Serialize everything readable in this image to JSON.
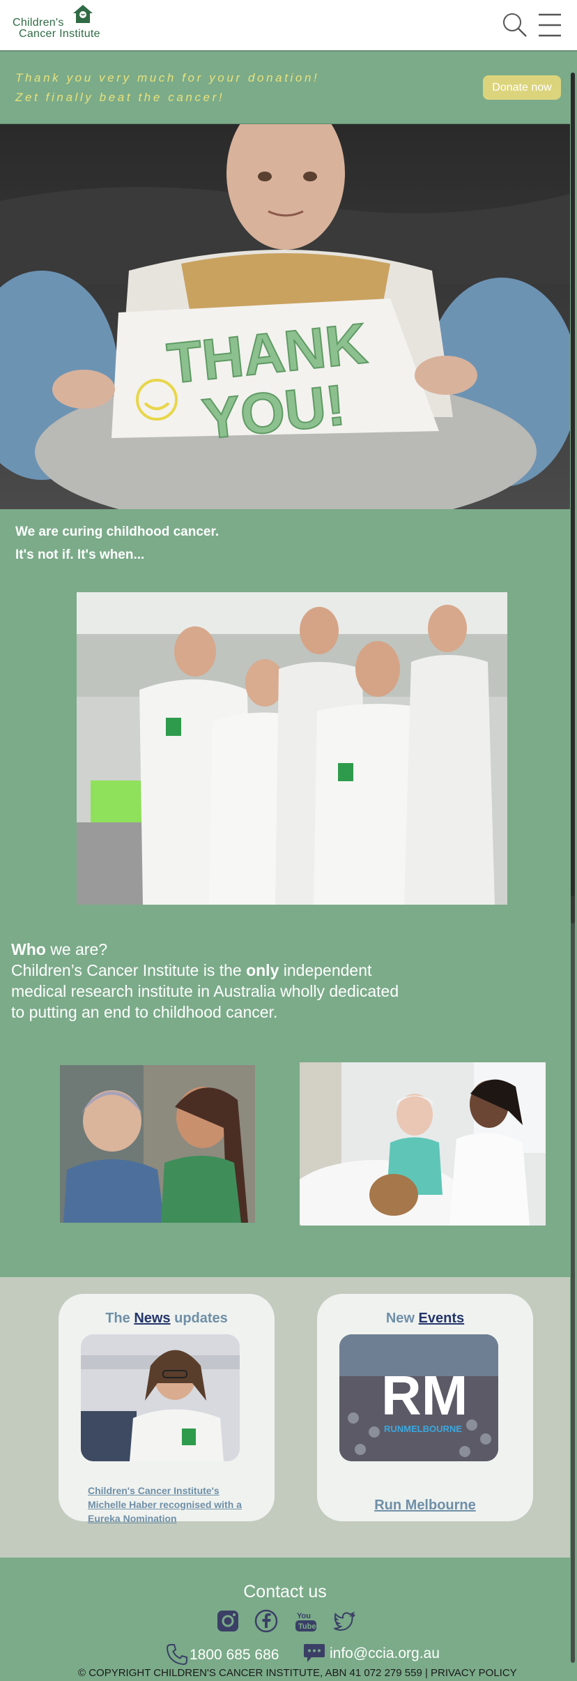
{
  "header": {
    "logo_line1": "Children's",
    "logo_line2": "Cancer Institute",
    "search_icon": "search-icon",
    "menu_icon": "hamburger-menu-icon"
  },
  "banner": {
    "line1": "Thank you very much for your donation!",
    "line2": "Zet finally beat the cancer!",
    "donate_label": "Donate now"
  },
  "hero": {
    "sign_line1": "THANK",
    "sign_line2": "YOU!"
  },
  "intro": {
    "line1": "We are curing childhood cancer.",
    "line2": "It's not if. It's when..."
  },
  "who": {
    "who_word": "Who",
    "who_rest": " we are?",
    "text_a": "Children’s Cancer Institute is the ",
    "only_word": "only",
    "text_b": " independent medical research institute in Australia wholly dedicated to putting an end to childhood cancer."
  },
  "news_card": {
    "title_prefix": "The ",
    "title_link": "News",
    "title_suffix": " updates",
    "article_link": "Children's Cancer Institute's Michelle Haber recognised with a Eureka Nomination"
  },
  "events_card": {
    "title_prefix": "New ",
    "title_link": "Events",
    "event_logo_text": "RM",
    "event_logo_sub": "RUNMELBOURNE",
    "event_link": "Run Melbourne"
  },
  "footer": {
    "contact_title": "Contact us",
    "social_icons": [
      "instagram-icon",
      "facebook-icon",
      "youtube-icon",
      "twitter-icon"
    ],
    "phone": "1800 685 686",
    "email": "info@ccia.org.au",
    "copyright": "© COPYRIGHT CHILDREN'S CANCER INSTITUTE, ABN 41 072 279 559 | ",
    "privacy": "PRIVACY POLICY"
  },
  "colors": {
    "brand_green": "#7bab89",
    "banner_text": "#e9e27a",
    "donate_button": "#dcd47c",
    "card_bg": "#eff2ef",
    "card_section_bg": "#c3cbbf",
    "link_navy": "#24356a",
    "link_muted": "#6f8fa7"
  }
}
